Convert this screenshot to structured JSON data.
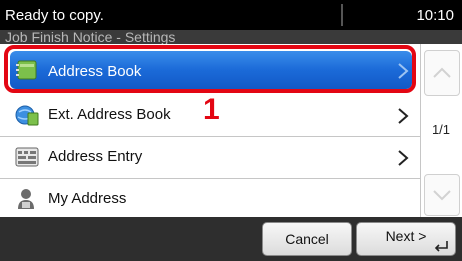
{
  "status": {
    "message": "Ready to copy.",
    "time": "10:10"
  },
  "title": "Job Finish Notice - Settings",
  "items": [
    {
      "label": "Address Book",
      "icon": "address-book-icon",
      "selected": true
    },
    {
      "label": "Ext. Address Book",
      "icon": "ext-address-book-icon",
      "selected": false
    },
    {
      "label": "Address Entry",
      "icon": "keyboard-icon",
      "selected": false
    },
    {
      "label": "My Address",
      "icon": "user-icon",
      "selected": false
    }
  ],
  "callout": "1",
  "scroll": {
    "page": "1/1"
  },
  "buttons": {
    "cancel": "Cancel",
    "next": "Next >"
  },
  "colors": {
    "selected_row": "#1b6ad8",
    "highlight": "#e30613",
    "status_bg": "#000000"
  }
}
